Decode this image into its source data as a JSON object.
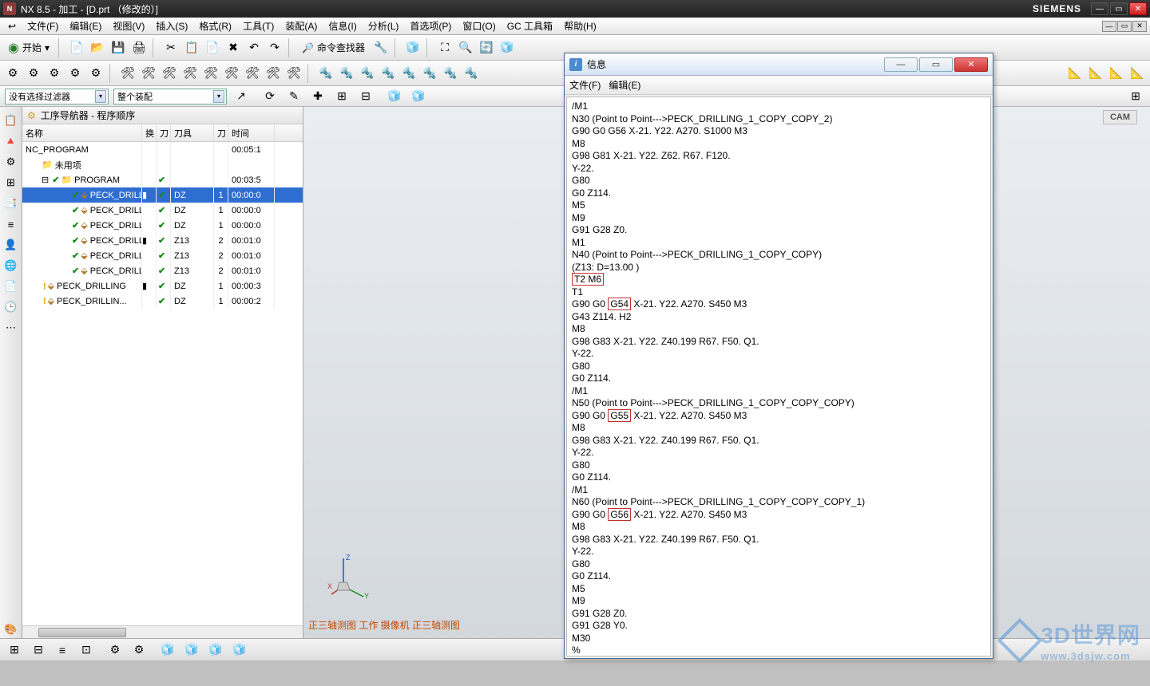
{
  "title": "NX 8.5 - 加工 - [D.prt （修改的）]",
  "brand": "SIEMENS",
  "menus": [
    "文件(F)",
    "编辑(E)",
    "视图(V)",
    "插入(S)",
    "格式(R)",
    "工具(T)",
    "装配(A)",
    "信息(I)",
    "分析(L)",
    "首选项(P)",
    "窗口(O)",
    "GC 工具箱",
    "帮助(H)"
  ],
  "start_label": "开始",
  "cmd_finder": "命令查找器",
  "filter1": "没有选择过滤器",
  "filter2": "整个装配",
  "cam_tag": "CAM",
  "nav_title": "工序导航器 - 程序顺序",
  "cols": {
    "name": "名称",
    "c1": "换",
    "c2": "刀",
    "tool": "刀具",
    "c3": "刀",
    "time": "时间"
  },
  "tree": [
    {
      "name": "NC_PROGRAM",
      "tool": "",
      "n": "",
      "time": "00:05:1",
      "lvl": 0,
      "icon": "root"
    },
    {
      "name": "未用项",
      "tool": "",
      "n": "",
      "time": "",
      "lvl": 1,
      "icon": "folder"
    },
    {
      "name": "PROGRAM",
      "tool": "",
      "n": "",
      "time": "00:03:5",
      "lvl": 1,
      "icon": "folder",
      "exp": "-",
      "chk": true
    },
    {
      "name": "PECK_DRILL...",
      "tool": "DZ",
      "n": "1",
      "time": "00:00:0",
      "lvl": 2,
      "icon": "op",
      "chk": true,
      "c1": "b",
      "sel": true
    },
    {
      "name": "PECK_DRILL...",
      "tool": "DZ",
      "n": "1",
      "time": "00:00:0",
      "lvl": 2,
      "icon": "op",
      "chk": true
    },
    {
      "name": "PECK_DRILL...",
      "tool": "DZ",
      "n": "1",
      "time": "00:00:0",
      "lvl": 2,
      "icon": "op",
      "chk": true
    },
    {
      "name": "PECK_DRILL...",
      "tool": "Z13",
      "n": "2",
      "time": "00:01:0",
      "lvl": 2,
      "icon": "op",
      "chk": true,
      "c1": "b"
    },
    {
      "name": "PECK_DRILL...",
      "tool": "Z13",
      "n": "2",
      "time": "00:01:0",
      "lvl": 2,
      "icon": "op",
      "chk": true
    },
    {
      "name": "PECK_DRILL...",
      "tool": "Z13",
      "n": "2",
      "time": "00:01:0",
      "lvl": 2,
      "icon": "op",
      "chk": true
    },
    {
      "name": "PECK_DRILLING",
      "tool": "DZ",
      "n": "1",
      "time": "00:00:3",
      "lvl": 1,
      "icon": "op",
      "warn": true,
      "c1": "b"
    },
    {
      "name": "PECK_DRILLIN...",
      "tool": "DZ",
      "n": "1",
      "time": "00:00:2",
      "lvl": 1,
      "icon": "op",
      "warn": true
    }
  ],
  "axes": {
    "x": "XM",
    "y": "YM",
    "z": "ZM"
  },
  "view_label": "正三轴测图 工作 摄像机 正三轴测图",
  "info": {
    "title": "信息",
    "menus": [
      "文件(F)",
      "编辑(E)"
    ],
    "lines": [
      {
        "t": "/M1"
      },
      {
        "t": "N30 (Point to Point--->PECK_DRILLING_1_COPY_COPY_2)"
      },
      {
        "t": "G90 G0 G56 X-21. Y22. A270. S1000 M3"
      },
      {
        "t": "M8"
      },
      {
        "t": "G98 G81 X-21. Y22. Z62. R67. F120."
      },
      {
        "t": "Y-22."
      },
      {
        "t": "G80"
      },
      {
        "t": "G0 Z114."
      },
      {
        "t": "M5"
      },
      {
        "t": "M9"
      },
      {
        "t": "G91 G28 Z0."
      },
      {
        "t": "M1"
      },
      {
        "t": "N40 (Point to Point--->PECK_DRILLING_1_COPY_COPY)"
      },
      {
        "t": "(Z13: D=13.00 )"
      },
      {
        "pre": "",
        "box": "T2 M6",
        "post": ""
      },
      {
        "t": "T1"
      },
      {
        "pre": "G90 G0 ",
        "box": "G54",
        "post": " X-21. Y22. A270. S450 M3"
      },
      {
        "t": "G43 Z114. H2"
      },
      {
        "t": "M8"
      },
      {
        "t": "G98 G83 X-21. Y22. Z40.199 R67. F50. Q1."
      },
      {
        "t": "Y-22."
      },
      {
        "t": "G80"
      },
      {
        "t": "G0 Z114."
      },
      {
        "t": "/M1"
      },
      {
        "t": "N50 (Point to Point--->PECK_DRILLING_1_COPY_COPY_COPY)"
      },
      {
        "pre": "G90 G0 ",
        "box": "G55",
        "post": " X-21. Y22. A270. S450 M3"
      },
      {
        "t": "M8"
      },
      {
        "t": "G98 G83 X-21. Y22. Z40.199 R67. F50. Q1."
      },
      {
        "t": "Y-22."
      },
      {
        "t": "G80"
      },
      {
        "t": "G0 Z114."
      },
      {
        "t": "/M1"
      },
      {
        "t": "N60 (Point to Point--->PECK_DRILLING_1_COPY_COPY_COPY_1)"
      },
      {
        "pre": "G90 G0 ",
        "box": "G56",
        "post": " X-21. Y22. A270. S450 M3"
      },
      {
        "t": "M8"
      },
      {
        "t": "G98 G83 X-21. Y22. Z40.199 R67. F50. Q1."
      },
      {
        "t": "Y-22."
      },
      {
        "t": "G80"
      },
      {
        "t": "G0 Z114."
      },
      {
        "t": "M5"
      },
      {
        "t": "M9"
      },
      {
        "t": "G91 G28 Z0."
      },
      {
        "t": "G91 G28 Y0."
      },
      {
        "t": "M30"
      },
      {
        "t": "%"
      }
    ]
  },
  "watermark": "3D世界网",
  "watermark_url": "www.3dsjw.com"
}
